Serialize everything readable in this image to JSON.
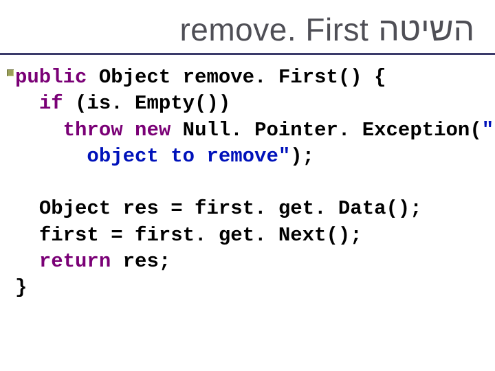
{
  "title": {
    "latin": "remove. First",
    "hebrew": "השיטה"
  },
  "code": {
    "line1_kw": "public",
    "line1_rest": " Object remove. First() {",
    "line2_kw": "if",
    "line2_rest": " (is. Empty())",
    "line3_kw1": "throw",
    "line3_kw2": "new",
    "line3_rest": " Null. Pointer. Exception(",
    "line3_str": "\"No",
    "line4_id": "object to remove\"",
    "line4_rest": ");",
    "line6_rest1": "Object res = first. get. Data();",
    "line7_rest": "first = first. get. Next();",
    "line8_kw": "return",
    "line8_rest": " res;",
    "line9_rest": "}"
  }
}
